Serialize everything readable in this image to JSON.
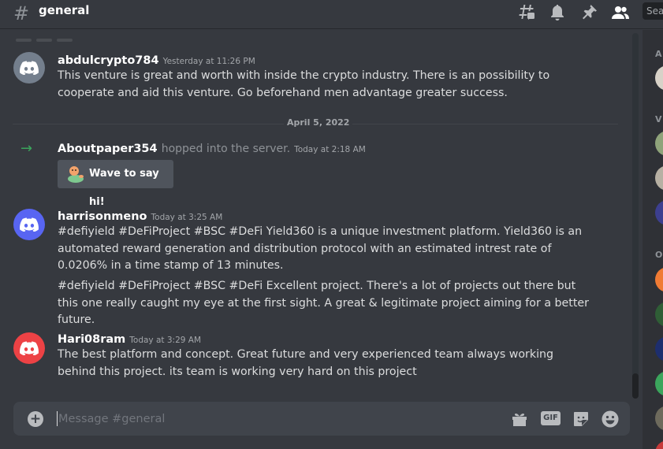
{
  "header": {
    "hash_symbol": "#",
    "channel_name": "general",
    "search_placeholder": "Search"
  },
  "messages": [
    {
      "author": "abdulcrypto784",
      "timestamp": "Yesterday at 11:26 PM",
      "avatar_color": "#747f8d",
      "paragraphs": [
        "This venture is great and worth with inside the crypto industry. There is an possibility to cooperate and aid this venture. Go beforehand men advantage greater success."
      ]
    },
    {
      "author": "harrisonmeno",
      "timestamp": "Today at 3:25 AM",
      "avatar_color": "#5865f2",
      "paragraphs": [
        "#defiyield #DeFiProject #BSC #DeFi Yield360 is a unique investment platform. Yield360 is an automated reward generation and distribution protocol with an estimated intrest rate of 0.0206% in a time stamp of 13 minutes.",
        "#defiyield #DeFiProject #BSC #DeFi Excellent project. There's a lot of projects out there but this one really caught my eye at the first sight. A great & legitimate project aiming for a better future."
      ]
    },
    {
      "author": "Hari08ram",
      "timestamp": "Today at 3:29 AM",
      "avatar_color": "#ed4245",
      "paragraphs": [
        "The best platform and concept. Great future and very experienced team always working behind this project. its team is working very hard on this project"
      ]
    }
  ],
  "date_divider": "April 5, 2022",
  "join_event": {
    "arrow": "→",
    "name": "Aboutpaper354",
    "text": "hopped into the server.",
    "timestamp": "Today at 2:18 AM",
    "wave_button_label": "Wave to say hi!"
  },
  "composer": {
    "placeholder": "Message #general",
    "plus_symbol": "+",
    "gif_label": "GIF"
  },
  "member_list": {
    "categories": [
      "A",
      "V",
      "O"
    ]
  },
  "colors": {
    "background": "#36393f",
    "join_arrow": "#3ba55c",
    "composer_bg": "#40444b",
    "member_bg": "#2f3136"
  }
}
